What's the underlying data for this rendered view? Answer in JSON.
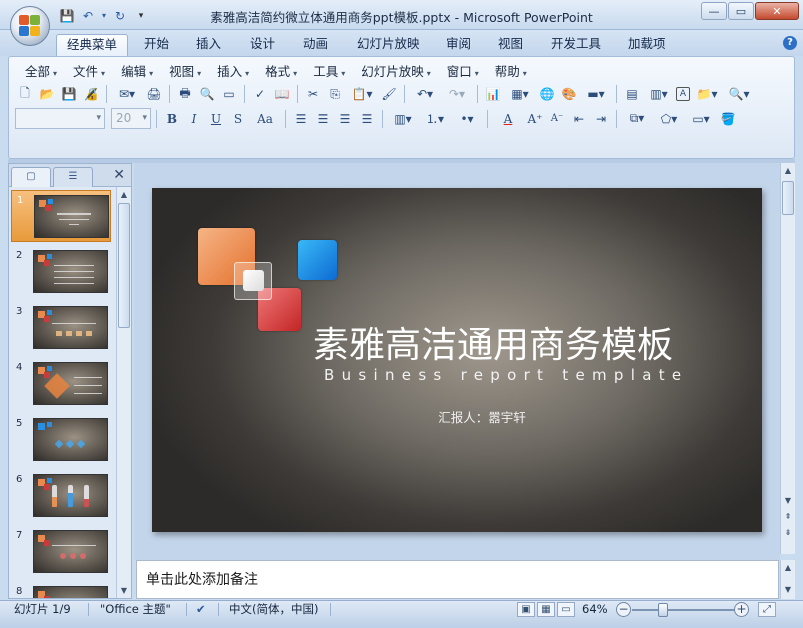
{
  "window": {
    "title": "素雅高洁简约微立体通用商务ppt模板.pptx - Microsoft PowerPoint",
    "minimize": "—",
    "restore": "▭",
    "close": "✕"
  },
  "ribbon_tabs": [
    "经典菜单",
    "开始",
    "插入",
    "设计",
    "动画",
    "幻灯片放映",
    "审阅",
    "视图",
    "开发工具",
    "加载项"
  ],
  "help_label": "?",
  "classic_menu": [
    "全部",
    "文件",
    "编辑",
    "视图",
    "插入",
    "格式",
    "工具",
    "幻灯片放映",
    "窗口",
    "帮助"
  ],
  "font": {
    "name": "",
    "size": "20"
  },
  "format_buttons": {
    "bold": "B",
    "italic": "I",
    "underline": "U",
    "shadow": "S",
    "case": "Aa",
    "font_color": "A"
  },
  "panel": {
    "close": "✕"
  },
  "thumbnails": [
    {
      "num": "1"
    },
    {
      "num": "2"
    },
    {
      "num": "3"
    },
    {
      "num": "4"
    },
    {
      "num": "5"
    },
    {
      "num": "6"
    },
    {
      "num": "7"
    },
    {
      "num": "8"
    }
  ],
  "slide": {
    "title": "素雅高洁通用商务模板",
    "subtitle": "Business report template",
    "reporter": "汇报人：嚣宇轩"
  },
  "notes_placeholder": "单击此处添加备注",
  "status": {
    "slide_indicator": "幻灯片 1/9",
    "theme": "\"Office 主题\"",
    "language": "中文(简体，中国)",
    "zoom": "64%"
  },
  "colors": {
    "accent_orange": "#e4712d",
    "accent_blue": "#0d6bd2",
    "accent_red": "#c32525",
    "ribbon_bg": "#dde8f5"
  }
}
